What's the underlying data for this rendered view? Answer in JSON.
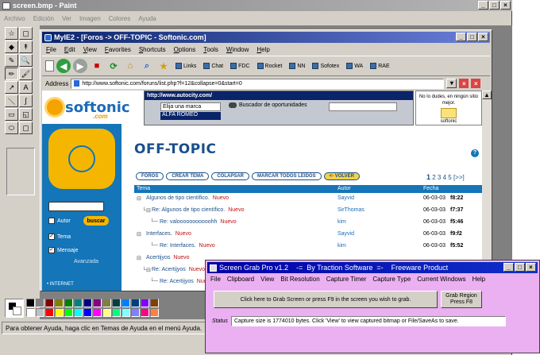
{
  "paint": {
    "title": "screen.bmp - Paint",
    "menu": [
      "Archivo",
      "Edición",
      "Ver",
      "Imagen",
      "Colores",
      "Ayuda"
    ],
    "tools": [
      "☆",
      "▢",
      "◆",
      "↟",
      "✎",
      "🔍",
      "✏",
      "🖌",
      "↗",
      "A",
      "＼",
      "∫",
      "▭",
      "◱",
      "⬭",
      "▢"
    ],
    "status": "Para obtener Ayuda, haga clic en Temas de Ayuda en el menú Ayuda.",
    "palette": [
      "#000000",
      "#808080",
      "#800000",
      "#808000",
      "#008000",
      "#008080",
      "#000080",
      "#800080",
      "#808040",
      "#004040",
      "#0080ff",
      "#004080",
      "#8000ff",
      "#804000",
      "#ffffff",
      "#c0c0c0",
      "#ff0000",
      "#ffff00",
      "#00ff00",
      "#00ffff",
      "#0000ff",
      "#ff00ff",
      "#ffff80",
      "#00ff80",
      "#80ffff",
      "#8080ff",
      "#ff0080",
      "#ff8040"
    ]
  },
  "ie": {
    "title": "MyIE2 - [Foros -> OFF-TOPIC - Softonic.com]",
    "menu": [
      "File",
      "Edit",
      "View",
      "Favorites",
      "Shortcuts",
      "Options",
      "Tools",
      "Window",
      "Help"
    ],
    "links": [
      "Links",
      "Chat",
      "FDC",
      "Rocket",
      "NN",
      "Sofotex",
      "WA",
      "RAE"
    ],
    "address_label": "Address",
    "url": "http://www.softonic.com/foruns/list.php?f=12&collapse=0&start=0",
    "page": {
      "logo_text": "softonic",
      "logo_dotcom": ".com",
      "autocity_title": "http://www.autocity.com/",
      "autocity_select": "Elija una marca",
      "autocity_option": "ALFA ROMEO",
      "autocity_search": "Buscador de oportunidades",
      "promo_text": "No lo dudes, en ningún sitio mejor.",
      "promo_brand": "softonic",
      "autor_label": "Autor",
      "buscar_label": "buscar",
      "tema_label": "Tema",
      "mensaje_label": "Mensaje",
      "avanzada_label": "Avanzada",
      "internet_label": "• INTERNET",
      "heading": "OFF-TOPIC",
      "nav": [
        "FOROS",
        "CREAR TEMA",
        "COLAPSAR",
        "MARCAR TODOS LEIDOS",
        "<- VOLVER"
      ],
      "pages_current": "1",
      "pages_rest": "2 3 4 5 [>>]",
      "col_tema": "Tema",
      "col_autor": "Autor",
      "col_fecha": "Fecha",
      "rows": [
        {
          "tree": "⊟",
          "title": "Algunos de tipo científico.",
          "new": "Nuevo",
          "author": "Sayvid",
          "date": "06-03-03",
          "time": "f8:22"
        },
        {
          "tree": "└⊟",
          "title": "Re: Algunos de tipo científico.",
          "new": "Nuevo",
          "author": "SirThomas",
          "date": "06-03-03",
          "time": "f7:37"
        },
        {
          "tree": "└─",
          "title": "Re: valooooooooooohh",
          "new": "Nuevo",
          "author": "kim",
          "date": "06-03-03",
          "time": "f5:46"
        },
        {
          "tree": "⊟",
          "title": "Interfaces.",
          "new": "Nuevo",
          "author": "Sayvid",
          "date": "06-03-03",
          "time": "f9:f2"
        },
        {
          "tree": "└─",
          "title": "Re: Interfaces.",
          "new": "Nuevo",
          "author": "kim",
          "date": "06-03-03",
          "time": "f5:52"
        },
        {
          "tree": "⊟",
          "title": "Acertijyos",
          "new": "Nuevo",
          "author": "",
          "date": "",
          "time": ""
        },
        {
          "tree": "└⊟",
          "title": "Re: Acertijyos",
          "new": "Nuevo",
          "author": "",
          "date": "",
          "time": ""
        },
        {
          "tree": "└─",
          "title": "Re: Acertijyos",
          "new": "Nuevo",
          "author": "",
          "date": "",
          "time": ""
        }
      ]
    }
  },
  "screengrab": {
    "title": "Screen Grab Pro v1.2    -=  By Traction Software  =-    Freeware Product",
    "menu": [
      "File",
      "Clipboard",
      "View",
      "Bit Resolution",
      "Capture Timer",
      "Capture Type",
      "Current Windows",
      "Help"
    ],
    "grab_button": "Click here to Grab Screen or press F9 in the screen you wish to grab.",
    "region_button": "Grab Region Press F8",
    "status_label": "Status",
    "status_value": "Capture size is 1774010 bytes. Click 'View' to view captured bitmap or File/SaveAs to save."
  }
}
